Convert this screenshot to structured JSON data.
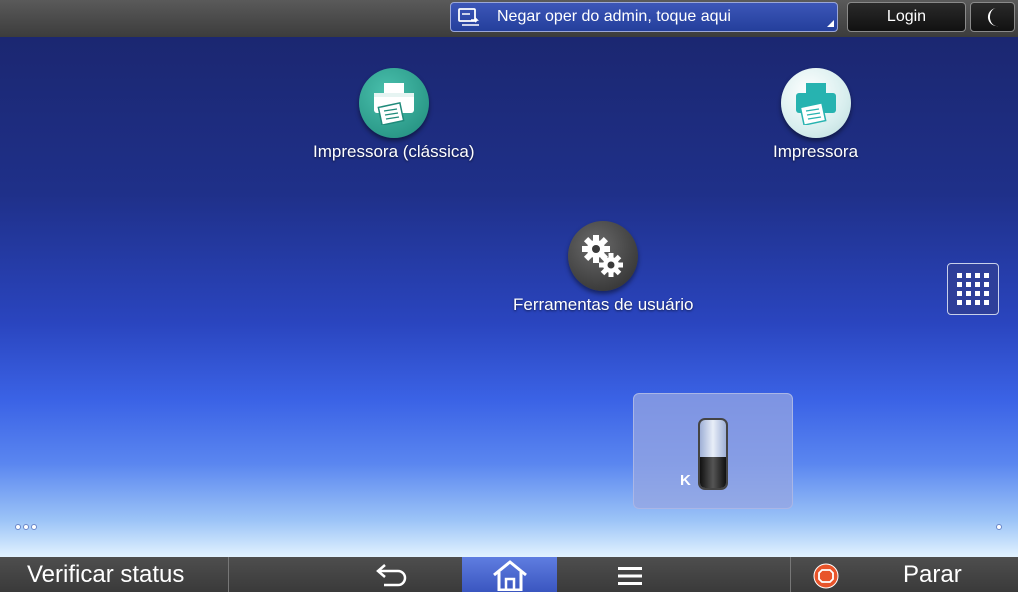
{
  "topbar": {
    "admin_message": "Negar oper do admin, toque aqui",
    "login_label": "Login",
    "moon_icon": "moon-icon"
  },
  "apps": [
    {
      "label": "Impressora (clássica)",
      "icon": "printer-classic-icon",
      "color": "#2a9a8a"
    },
    {
      "label": "Impressora",
      "icon": "printer-icon",
      "color": "#27b3b0"
    },
    {
      "label": "Ferramentas de usuário",
      "icon": "gear-icon",
      "color": "#3a3a3a"
    }
  ],
  "toner": {
    "color_label": "K",
    "level_percent": 45
  },
  "bottombar": {
    "status_label": "Verificar status",
    "stop_label": "Parar"
  },
  "colors": {
    "accent": "#3a56c0",
    "stop": "#e8542a"
  }
}
